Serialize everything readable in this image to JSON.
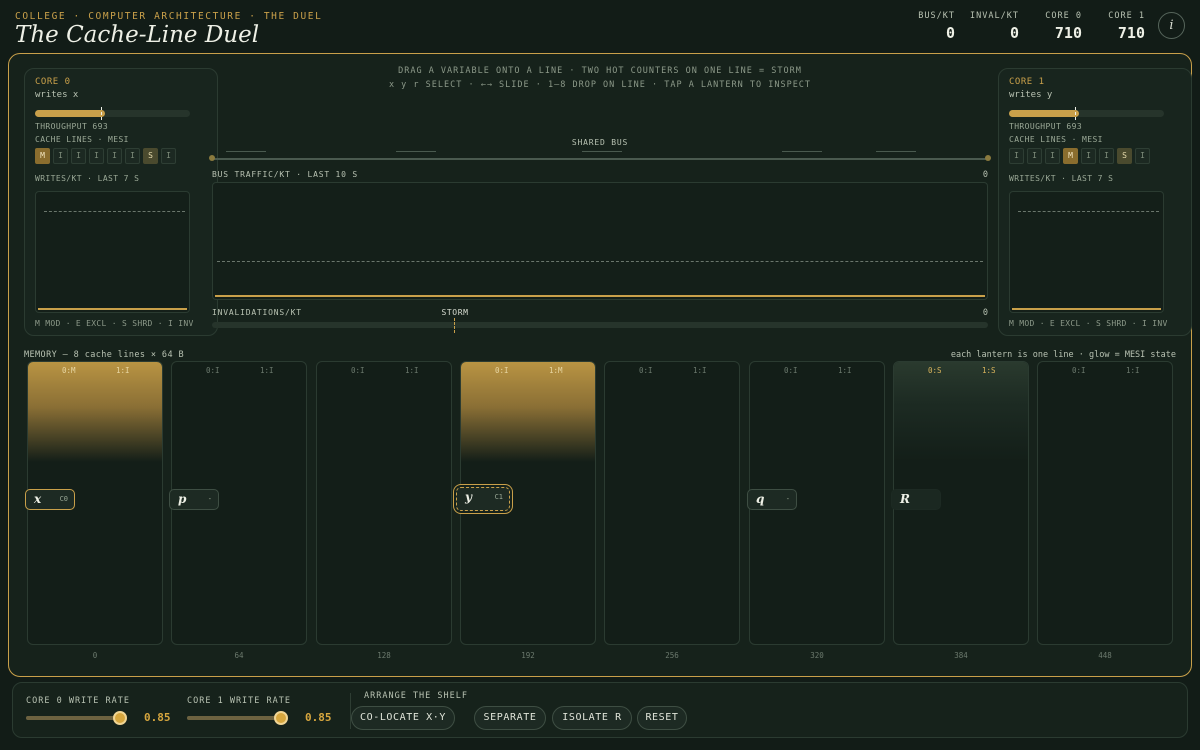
{
  "header": {
    "breadcrumb": "COLLEGE · COMPUTER ARCHITECTURE · THE DUEL",
    "title": "The Cache-Line Duel",
    "stats": [
      {
        "label": "BUS/KT",
        "value": "0"
      },
      {
        "label": "INVAL/KT",
        "value": "0"
      },
      {
        "label": "CORE 0",
        "value": "710"
      },
      {
        "label": "CORE 1",
        "value": "710"
      }
    ],
    "info_icon": "i"
  },
  "instructions": {
    "line1": "DRAG A VARIABLE ONTO A LINE · TWO HOT COUNTERS ON ONE LINE = STORM",
    "line2": "x y r SELECT · ←→ SLIDE · 1–8 DROP ON LINE · TAP A LANTERN TO INSPECT"
  },
  "cores": [
    {
      "title": "CORE 0",
      "subtitle": "writes x",
      "throughput_fraction": 0.45,
      "throughput": "THROUGHPUT 693",
      "cache_label": "CACHE LINES · MESI",
      "mesi": [
        "M",
        "I",
        "I",
        "I",
        "I",
        "I",
        "S",
        "I"
      ],
      "writes_label": "WRITES/KT · LAST 7 S",
      "legend": "M MOD · E EXCL · S SHRD · I INV"
    },
    {
      "title": "CORE 1",
      "subtitle": "writes y",
      "throughput_fraction": 0.45,
      "throughput": "THROUGHPUT 693",
      "cache_label": "CACHE LINES · MESI",
      "mesi": [
        "I",
        "I",
        "I",
        "M",
        "I",
        "I",
        "S",
        "I"
      ],
      "writes_label": "WRITES/KT · LAST 7 S",
      "legend": "M MOD · E EXCL · S SHRD · I INV"
    }
  ],
  "bus": {
    "label": "SHARED BUS",
    "traffic_label": "BUS TRAFFIC/KT · LAST 10 S",
    "traffic_value": "0",
    "inval_label": "INVALIDATIONS/KT",
    "inval_value": "0",
    "storm_label": "STORM"
  },
  "memory": {
    "caption": "MEMORY — 8 cache lines × 64 B",
    "hint": "each lantern is one line · glow = MESI state",
    "lines": [
      {
        "offset": "0",
        "c0": "0:M",
        "c1": "1:I",
        "glow": "m"
      },
      {
        "offset": "64",
        "c0": "0:I",
        "c1": "1:I",
        "glow": ""
      },
      {
        "offset": "128",
        "c0": "0:I",
        "c1": "1:I",
        "glow": ""
      },
      {
        "offset": "192",
        "c0": "0:I",
        "c1": "1:M",
        "glow": "m"
      },
      {
        "offset": "256",
        "c0": "0:I",
        "c1": "1:I",
        "glow": ""
      },
      {
        "offset": "320",
        "c0": "0:I",
        "c1": "1:I",
        "glow": ""
      },
      {
        "offset": "384",
        "c0": "0:S",
        "c1": "1:S",
        "glow": "s"
      },
      {
        "offset": "448",
        "c0": "0:I",
        "c1": "1:I",
        "glow": ""
      }
    ],
    "variables": [
      {
        "name": "x",
        "owner": "C0",
        "line": 0
      },
      {
        "name": "p",
        "owner": "-",
        "line": 1
      },
      {
        "name": "y",
        "owner": "C1",
        "line": 3
      },
      {
        "name": "q",
        "owner": "-",
        "line": 5
      },
      {
        "name": "R",
        "owner": "",
        "line": 6
      }
    ]
  },
  "controls": {
    "core0_label": "CORE 0 WRITE RATE",
    "core0_rate": "0.85",
    "core1_label": "CORE 1 WRITE RATE",
    "core1_rate": "0.85",
    "arrange_label": "ARRANGE THE SHELF",
    "buttons": [
      "CO-LOCATE X·Y",
      "SEPARATE",
      "ISOLATE R",
      "RESET"
    ]
  },
  "colors": {
    "accent": "#c9a04a",
    "background": "#121c17",
    "panel": "#18251e"
  }
}
